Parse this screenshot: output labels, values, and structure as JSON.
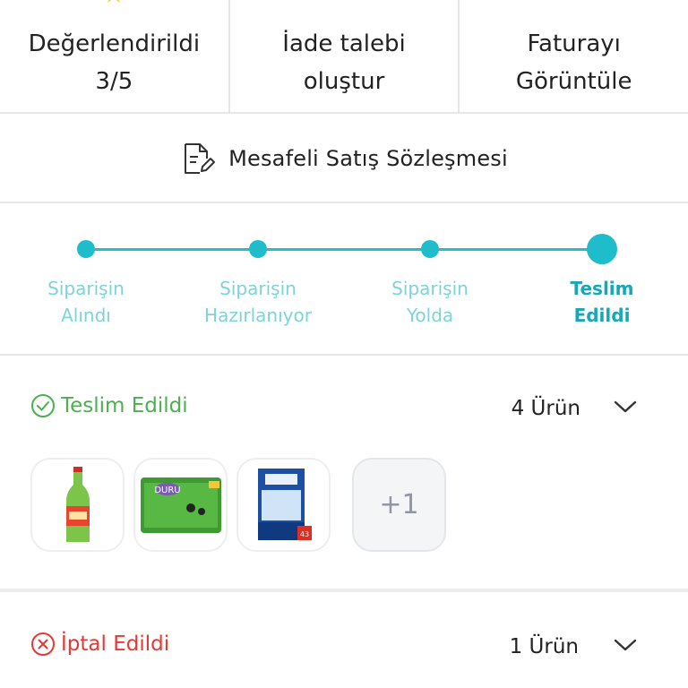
{
  "actions": [
    {
      "label_line1": "Değerlendirildi",
      "label_line2": "3/5",
      "icon": "star-icon"
    },
    {
      "label_line1": "İade talebi",
      "label_line2": "oluştur",
      "icon": "return-box-icon"
    },
    {
      "label_line1": "Faturayı",
      "label_line2": "Görüntüle",
      "icon": "receipt-icon"
    }
  ],
  "contract": {
    "label": "Mesafeli Satış Sözleşmesi",
    "icon": "document-edit-icon"
  },
  "stepper": {
    "steps": [
      {
        "line1": "Siparişin",
        "line2": "Alındı"
      },
      {
        "line1": "Siparişin",
        "line2": "Hazırlanıyor"
      },
      {
        "line1": "Siparişin",
        "line2": "Yolda"
      },
      {
        "line1": "Teslim",
        "line2": "Edildi"
      }
    ],
    "active_index": 3,
    "accent": "#1fbccc"
  },
  "delivered_group": {
    "status": "Teslim Edildi",
    "status_color": "#4caf50",
    "count": "4 Ürün",
    "products": [
      "Uludağ gazoz bottle",
      "Duru soap",
      "Finish makine tuzu 1300 gr"
    ],
    "more": "+1"
  },
  "cancelled_group": {
    "status": "İptal Edildi",
    "status_color": "#e53935",
    "count": "1 Ürün"
  }
}
